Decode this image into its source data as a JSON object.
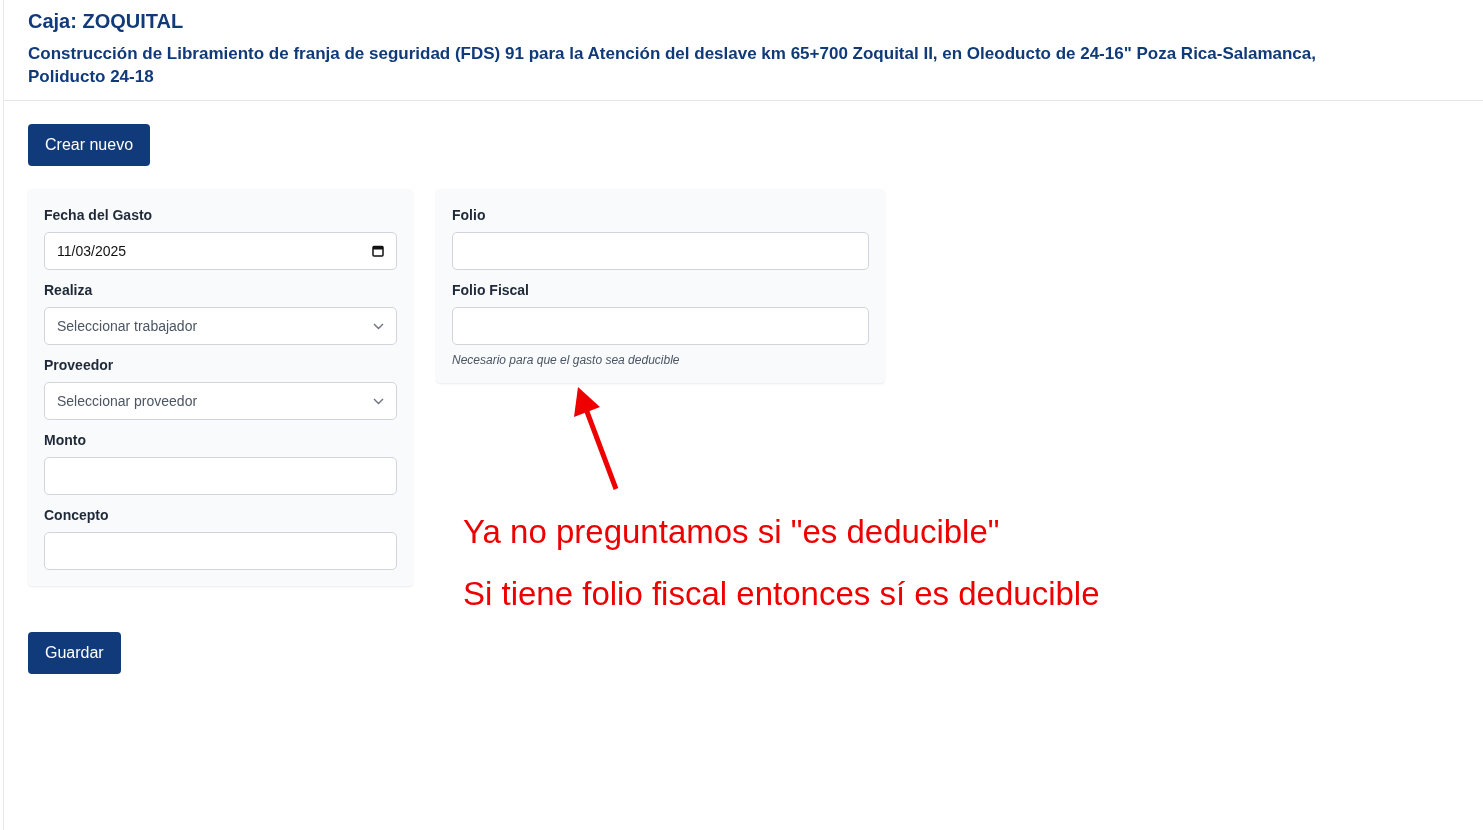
{
  "header": {
    "title": "Caja: ZOQUITAL",
    "subtitle": "Construcción de Libramiento de franja de seguridad (FDS) 91 para la Atención del deslave km 65+700 Zoquital II, en Oleoducto de 24-16\" Poza Rica-Salamanca, Poliducto 24-18"
  },
  "create_button": "Crear nuevo",
  "left_card": [
    {
      "kind": "date",
      "label": "Fecha del Gasto",
      "value": "11/03/2025"
    },
    {
      "kind": "select",
      "label": "Realiza",
      "placeholder": "Seleccionar trabajador"
    },
    {
      "kind": "select",
      "label": "Proveedor",
      "placeholder": "Seleccionar proveedor"
    },
    {
      "kind": "text",
      "label": "Monto"
    },
    {
      "kind": "text",
      "label": "Concepto"
    }
  ],
  "right_card": [
    {
      "kind": "text",
      "label": "Folio"
    },
    {
      "kind": "text",
      "label": "Folio Fiscal",
      "hint": "Necesario para que el gasto sea deducible"
    }
  ],
  "annotation": {
    "lines": [
      "Ya no preguntamos si \"es deducible\"",
      "Si tiene folio fiscal entonces sí es deducible"
    ]
  },
  "save_button": "Guardar"
}
